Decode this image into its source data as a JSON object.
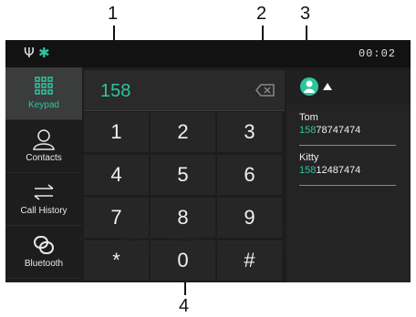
{
  "callouts": [
    "1",
    "2",
    "3",
    "4"
  ],
  "status": {
    "usb_icon": "usb-icon",
    "bt_icon": "bluetooth-icon",
    "time": "00:02"
  },
  "sidebar": {
    "items": [
      {
        "label": "Keypad",
        "icon": "keypad-icon",
        "active": true
      },
      {
        "label": "Contacts",
        "icon": "contacts-icon",
        "active": false
      },
      {
        "label": "Call History",
        "icon": "call-history-icon",
        "active": false
      },
      {
        "label": "Bluetooth",
        "icon": "bluetooth-link-icon",
        "active": false
      }
    ]
  },
  "dialer": {
    "number": "158",
    "backspace_icon": "backspace-icon"
  },
  "keys": [
    "1",
    "2",
    "3",
    "4",
    "5",
    "6",
    "7",
    "8",
    "9",
    "*",
    "0",
    "#"
  ],
  "contacts": {
    "header_icon": "contact-sort-icon",
    "list": [
      {
        "name": "Tom",
        "match": "158",
        "rest": "78747474"
      },
      {
        "name": "Kitty",
        "match": "158",
        "rest": "12487474"
      }
    ]
  },
  "colors": {
    "accent": "#2ec4a0",
    "background": "#1d1d1d"
  }
}
